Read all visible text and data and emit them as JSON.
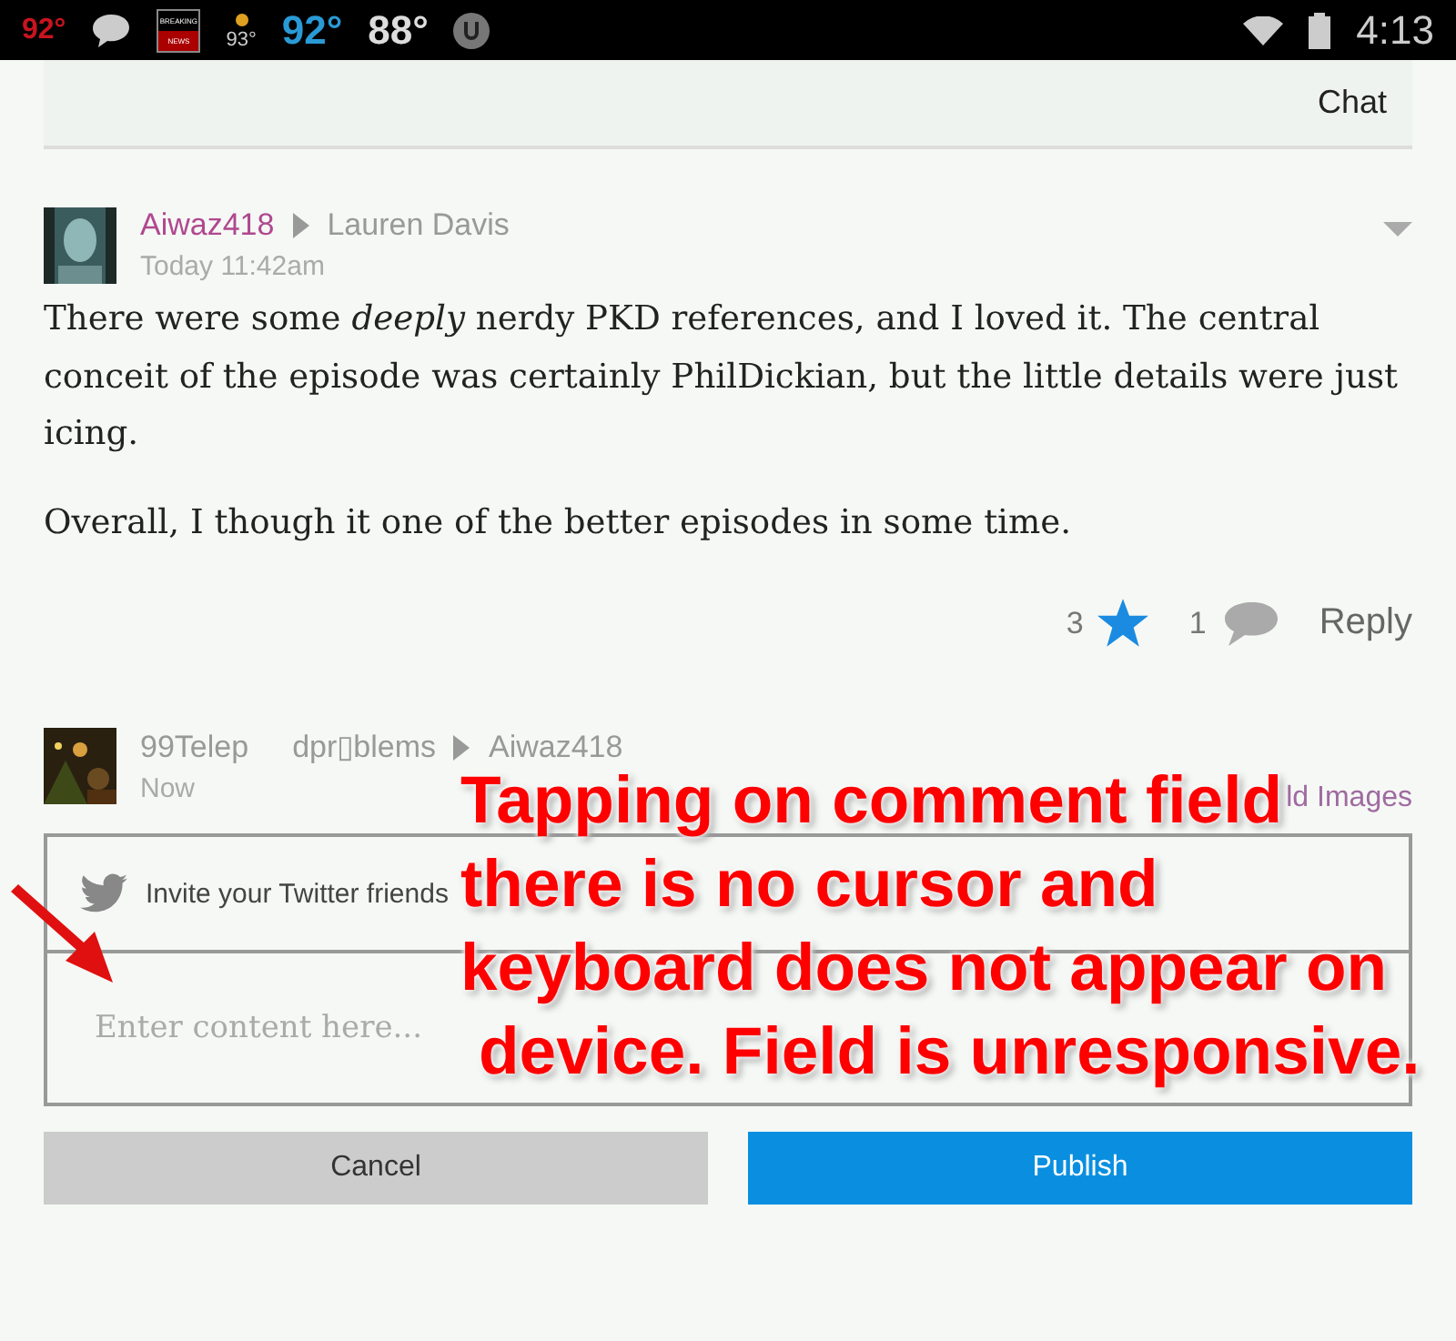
{
  "status_bar": {
    "left": [
      {
        "kind": "temp",
        "text": "92°",
        "color": "#c8141e"
      },
      {
        "kind": "chat"
      },
      {
        "kind": "news",
        "top": "BREAKING",
        "bottom": "NEWS"
      },
      {
        "kind": "weather",
        "text": "93°"
      },
      {
        "kind": "temp",
        "text": "92°",
        "color": "#2a9ad6"
      },
      {
        "kind": "temp",
        "text": "88°",
        "color": "#dddddd"
      },
      {
        "kind": "torrent"
      }
    ],
    "time": "4:13"
  },
  "header": {
    "lines": [
      "Chat"
    ]
  },
  "comments": [
    {
      "author": "Aiwaz418",
      "recipient": "Lauren Davis",
      "time": "Today 11:42am",
      "paragraphs": [
        "There were some *deeply* nerdy PKD references, and I loved it. The central conceit of the episode was certainly PhilDickian, but the little details were just icing.",
        "Overall, I though it one of the better episodes in some time."
      ],
      "stars": "3",
      "starred": true,
      "replies": "1",
      "reply": "Reply"
    }
  ],
  "composer": {
    "author": "99Telep",
    "alias": "dpr▯blems",
    "recipient": "Aiwaz418",
    "time": "Now",
    "add_images": "ld Images",
    "twitter": "Invite your Twitter friends",
    "placeholder": "Enter content here...",
    "buttons": [
      {
        "kind": "cancel",
        "label": "Cancel"
      },
      {
        "kind": "publish",
        "label": "Publish"
      }
    ]
  },
  "annotation": {
    "lines": [
      "Tapping on comment field",
      "there is no cursor and",
      "keyboard does not appear on",
      "device. Field is unresponsive."
    ]
  }
}
